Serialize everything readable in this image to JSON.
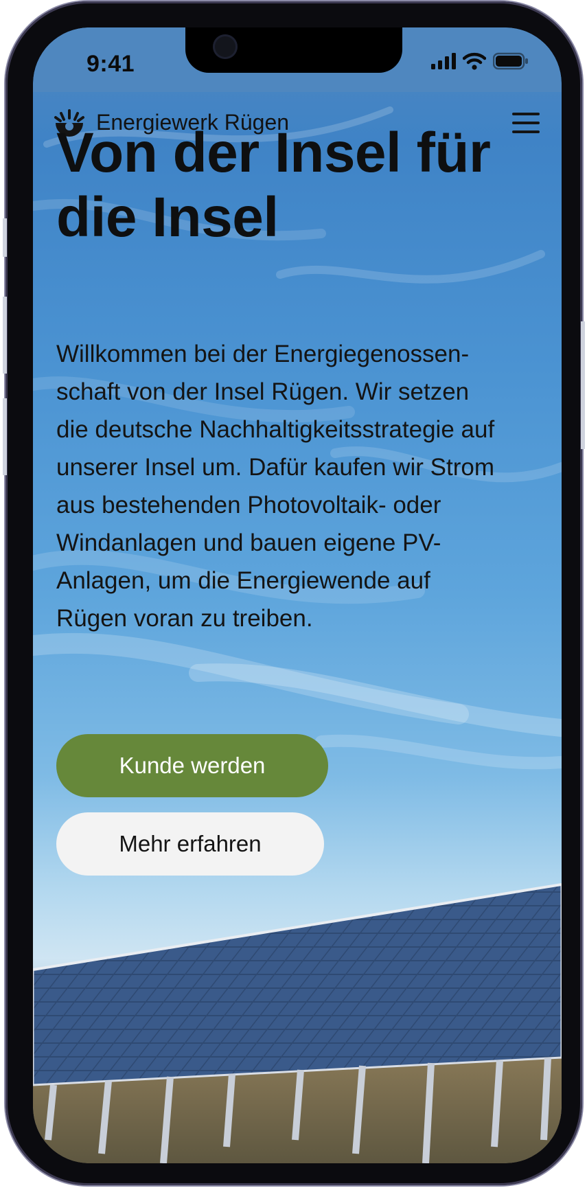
{
  "status_bar": {
    "time": "9:41",
    "icons": [
      "cellular-signal-icon",
      "wifi-icon",
      "battery-icon"
    ]
  },
  "header": {
    "brand": "Energiewerk Rügen",
    "logo_icon": "sun-logo-icon",
    "menu_icon": "hamburger-menu-icon"
  },
  "hero": {
    "title": "Von der Insel für die Insel",
    "intro": "Willkommen bei der Energiegenossen-schaft von der Insel Rügen. Wir setzen die deutsche Nachhaltigkeitsstrategie auf unserer Insel um. Dafür kaufen wir Strom aus bestehenden Photovoltaik- oder Windanlagen und bauen eigene PV-Anlagen, um die Energiewende auf Rügen voran zu treiben.",
    "primary_button": "Kunde werden",
    "secondary_button": "Mehr erfahren"
  },
  "colors": {
    "accent": "#66883a",
    "sky": "#4f87bf",
    "text": "#141414",
    "button_secondary_bg": "#f3f3f3"
  }
}
